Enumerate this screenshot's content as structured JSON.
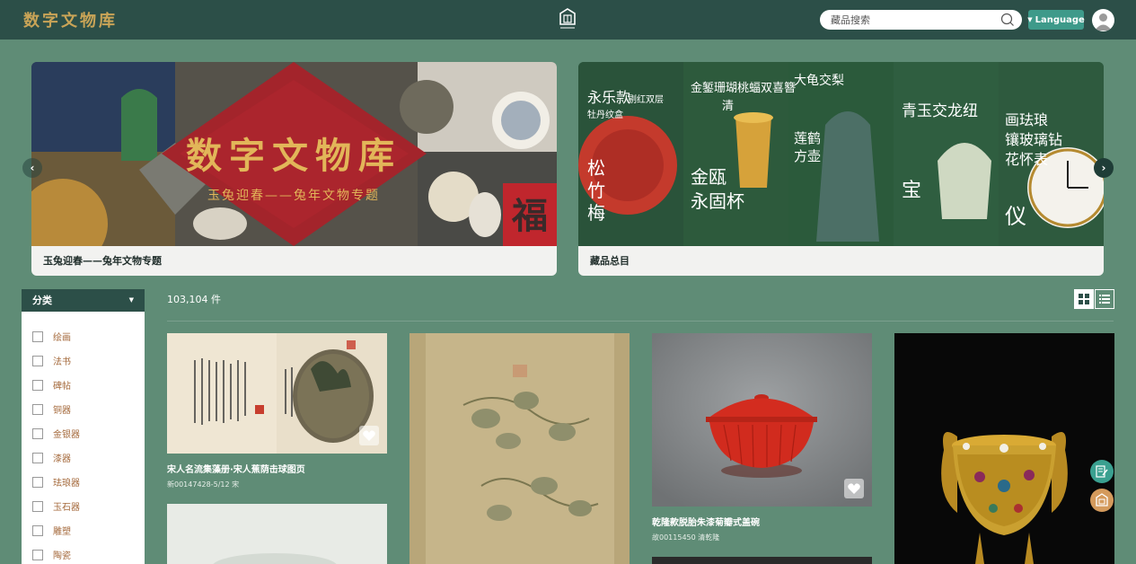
{
  "header": {
    "logo_text": "数字文物库",
    "search_placeholder": "藏品搜索",
    "language_label": "Language",
    "colors": {
      "bar": "#2c4f48",
      "accent": "#3e9a8a",
      "logo": "#c9a457"
    }
  },
  "banners": [
    {
      "caption": "玉兔迎春——兔年文物专题",
      "art_title": "数字文物库",
      "art_subtitle": "玉兔迎春——兔年文物专题",
      "art_seal": "福"
    },
    {
      "caption": "藏品总目",
      "art_texts": [
        "永乐款",
        "剔红双层",
        "牡丹纹盒",
        "松",
        "竹",
        "梅",
        "金錾珊瑚桃蝠双喜簪",
        "清",
        "金瓯",
        "永固杯",
        "大龟交梨",
        "莲鹤",
        "方壶",
        "青玉交龙纽",
        "宝",
        "画珐琅",
        "镶玻璃钻",
        "花怀表",
        "仪"
      ]
    }
  ],
  "sidebar": {
    "header": "分类",
    "categories": [
      "绘画",
      "法书",
      "碑帖",
      "铜器",
      "金银器",
      "漆器",
      "珐琅器",
      "玉石器",
      "雕塑",
      "陶瓷"
    ]
  },
  "results": {
    "count": "103,104 件",
    "items": [
      {
        "title": "宋人名流集藻册·宋人蕉荫击球图页",
        "sub": "新00147428-5/12 宋"
      },
      {
        "title": "乾隆款脱胎朱漆菊瓣式盖碗",
        "sub": "故00115450 清乾隆"
      }
    ]
  },
  "icons": {
    "search": "search-icon",
    "avatar": "user-avatar-icon",
    "grid_view": "grid-view-icon",
    "list_view": "list-view-icon",
    "favorite": "heart-icon",
    "feedback": "edit-note-icon",
    "museum": "museum-icon"
  }
}
